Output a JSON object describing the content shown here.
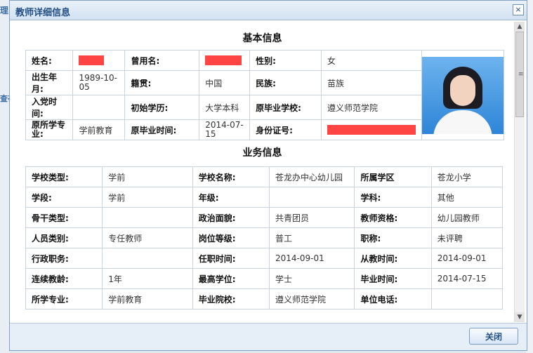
{
  "background": {
    "frag1": "理",
    "frag2": "查存"
  },
  "dialog": {
    "title": "教师详细信息",
    "close_symbol": "×",
    "close_button": "关闭"
  },
  "basic": {
    "heading": "基本信息",
    "labels": {
      "name": "姓名:",
      "former_name": "曾用名:",
      "gender": "性别:",
      "birth": "出生年月:",
      "native": "籍贯:",
      "ethnic": "民族:",
      "party": "入党时间:",
      "first_edu": "初始学历:",
      "orig_school": "原毕业学校:",
      "orig_major": "原所学专业:",
      "orig_grad": "原毕业时间:",
      "id_no": "身份证号:"
    },
    "values": {
      "gender": "女",
      "birth": "1989-10-05",
      "native": "中国",
      "ethnic": "苗族",
      "first_edu": "大学本科",
      "orig_school": "遵义师范学院",
      "orig_major": "学前教育",
      "orig_grad": "2014-07-15"
    }
  },
  "business": {
    "heading": "业务信息",
    "rows": [
      [
        "学校类型:",
        "学前",
        "学校名称:",
        "苍龙办中心幼儿园",
        "所属学区",
        "苍龙小学"
      ],
      [
        "学段:",
        "学前",
        "年级:",
        "",
        "学科:",
        "其他"
      ],
      [
        "骨干类型:",
        "",
        "政治面貌:",
        "共青团员",
        "教师资格:",
        "幼儿园教师"
      ],
      [
        "人员类别:",
        "专任教师",
        "岗位等级:",
        "普工",
        "职称:",
        "未评聘"
      ],
      [
        "行政职务:",
        "",
        "任职时间:",
        "2014-09-01",
        "从教时间:",
        "2014-09-01"
      ],
      [
        "连续教龄:",
        "1年",
        "最高学位:",
        "学士",
        "毕业时间:",
        "2014-07-15"
      ],
      [
        "所学专业:",
        "学前教育",
        "毕业院校:",
        "遵义师范学院",
        "单位电话:",
        ""
      ]
    ]
  }
}
